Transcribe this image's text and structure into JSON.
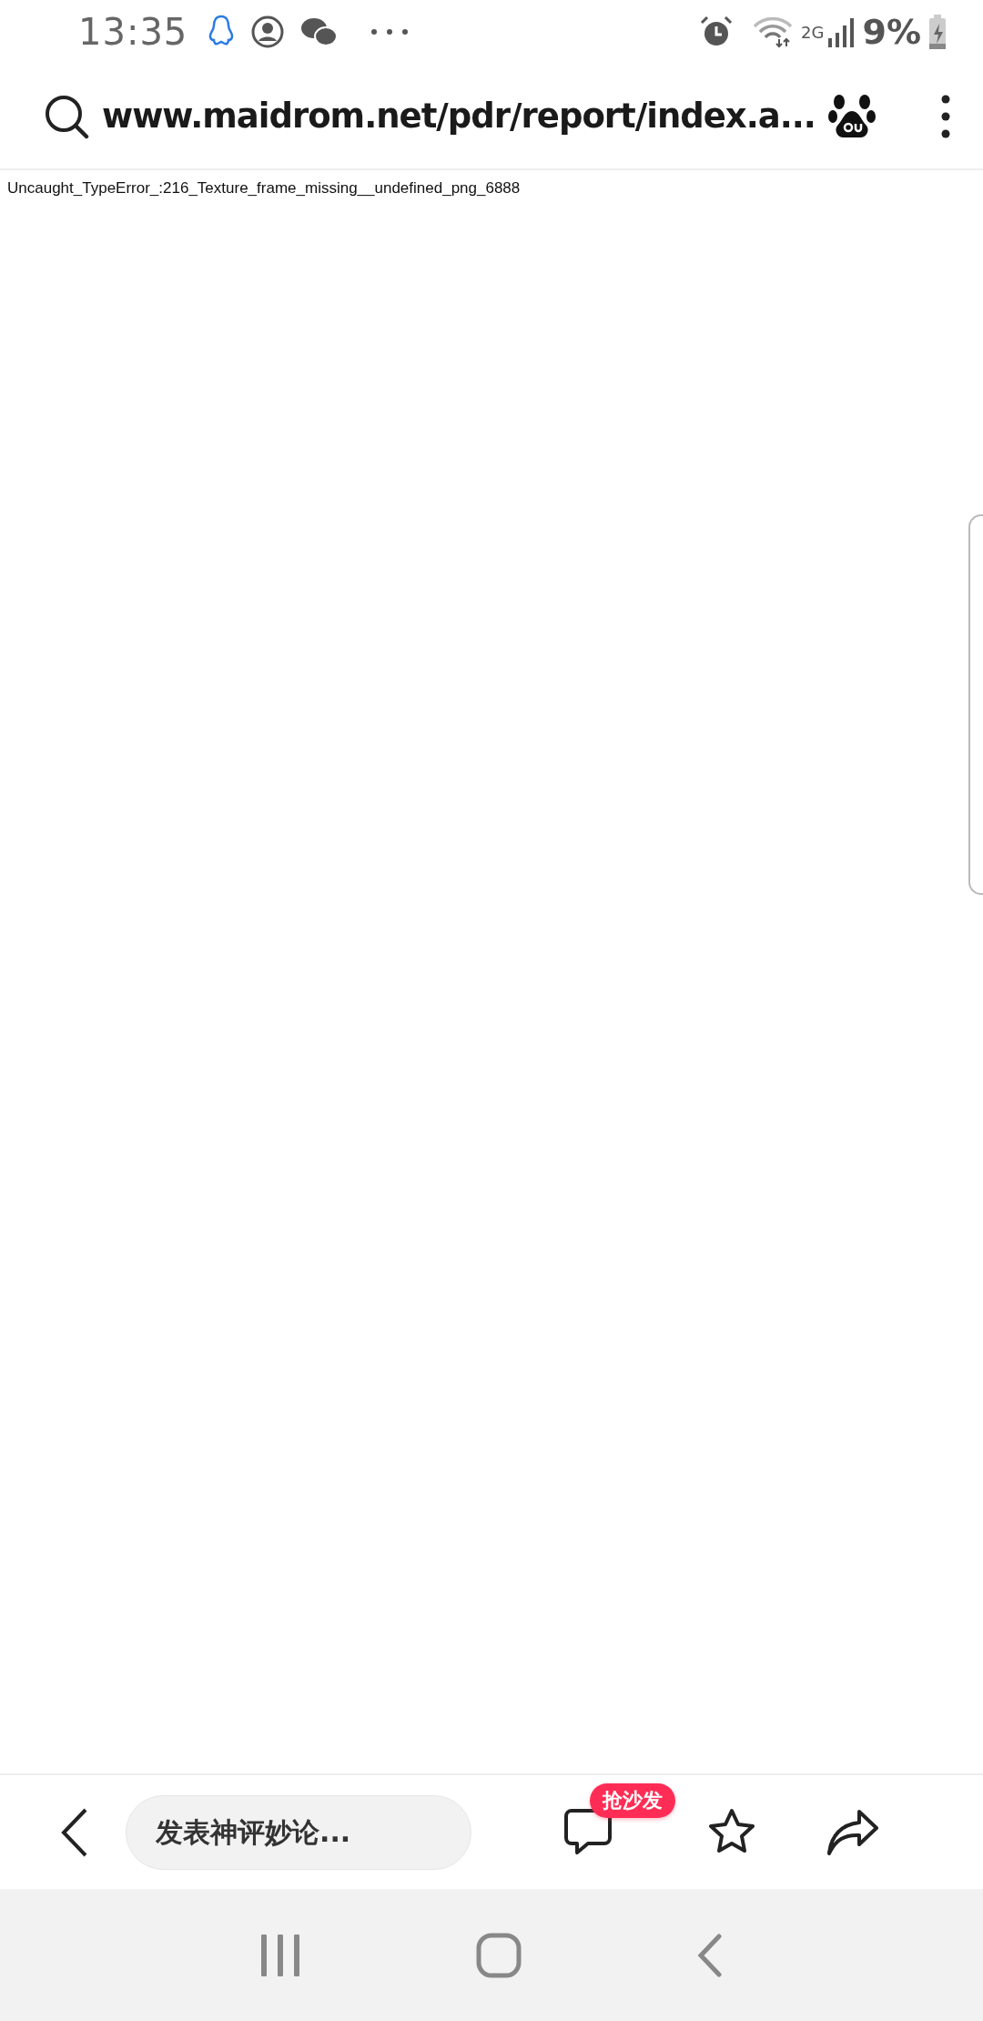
{
  "status_bar": {
    "time": "13:35",
    "network": "2G",
    "battery": "9%"
  },
  "address_bar": {
    "url": "www.maidrom.net/pdr/report/index.a..."
  },
  "page": {
    "error_message": "Uncaught_TypeError_:216_Texture_frame_missing__undefined_png_6888"
  },
  "bottom_toolbar": {
    "comment_field": {
      "placeholder": "发表神评妙论..."
    },
    "comment_badge": "抢沙发"
  }
}
